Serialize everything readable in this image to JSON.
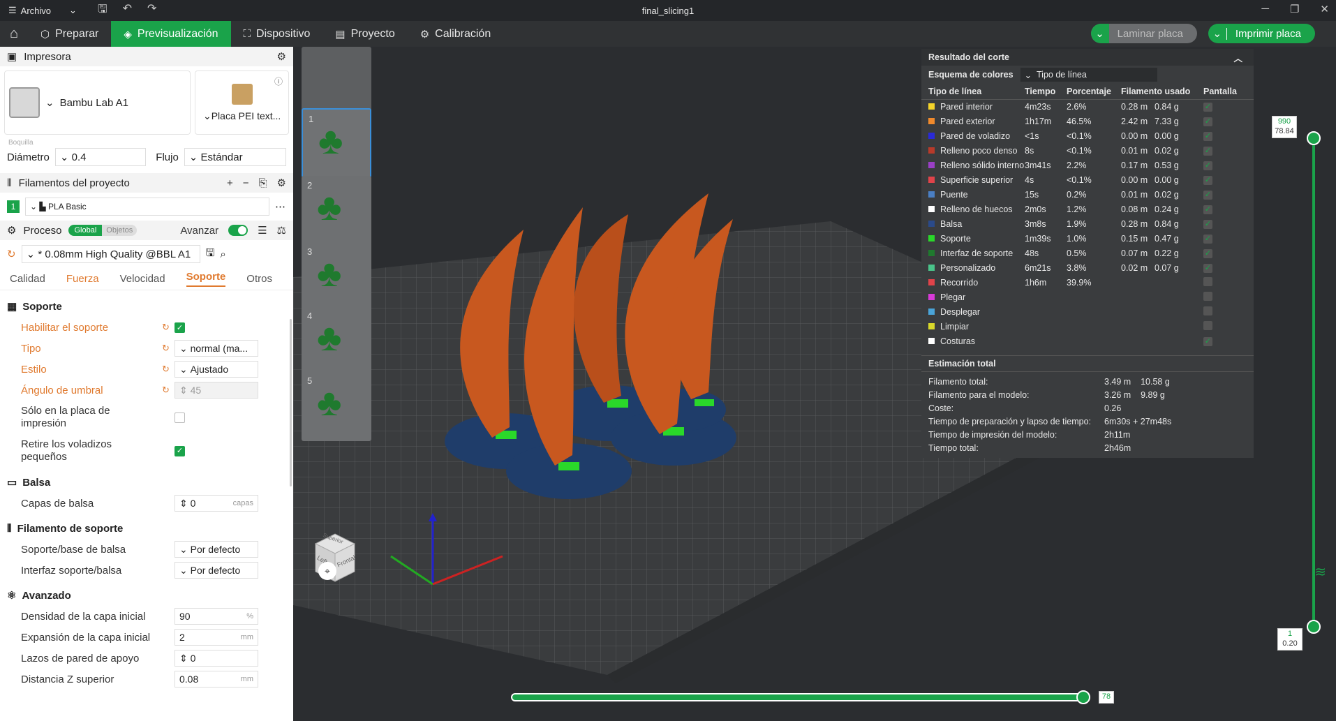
{
  "titlebar": {
    "menu_label": "Archivo",
    "window_title": "final_slicing1"
  },
  "nav": {
    "tabs": [
      {
        "label": "Preparar"
      },
      {
        "label": "Previsualización"
      },
      {
        "label": "Dispositivo"
      },
      {
        "label": "Proyecto"
      },
      {
        "label": "Calibración"
      }
    ],
    "slice_label": "Laminar placa",
    "print_label": "Imprimir placa"
  },
  "sidebar": {
    "printer_header": "Impresora",
    "printer_name": "Bambu Lab A1",
    "plate_name": "Placa PEI text...",
    "nozzle_label": "Boquilla",
    "diameter_label": "Diámetro",
    "diameter_value": "0.4",
    "flow_label": "Flujo",
    "flow_value": "Estándar",
    "filaments_header": "Filamentos del proyecto",
    "filament_index": "1",
    "filament_name": "PLA Basic",
    "process_label": "Proceso",
    "global_label": "Global",
    "objects_label": "Objetos",
    "advanced_label": "Avanzar",
    "profile": "* 0.08mm High Quality @BBL A1",
    "tabs": [
      "Calidad",
      "Fuerza",
      "Velocidad",
      "Soporte",
      "Otros"
    ],
    "groups": {
      "support": "Soporte",
      "raft": "Balsa",
      "support_filament": "Filamento de soporte",
      "advanced": "Avanzado"
    },
    "options": {
      "enable_support": "Habilitar el soporte",
      "type": "Tipo",
      "type_value": "normal (ma...",
      "style": "Estilo",
      "style_value": "Ajustado",
      "threshold": "Ángulo de umbral",
      "threshold_value": "45",
      "only_plate": "Sólo en la placa de impresión",
      "remove_small": "Retire los voladizos pequeños",
      "raft_layers": "Capas de balsa",
      "raft_layers_value": "0",
      "raft_layers_unit": "capas",
      "support_base": "Soporte/base de balsa",
      "support_base_value": "Por defecto",
      "support_interface": "Interfaz soporte/balsa",
      "support_interface_value": "Por defecto",
      "initial_density": "Densidad de la capa inicial",
      "initial_density_value": "90",
      "initial_density_unit": "%",
      "initial_expansion": "Expansión de la capa inicial",
      "initial_expansion_value": "2",
      "initial_expansion_unit": "mm",
      "wall_loops": "Lazos de pared de apoyo",
      "wall_loops_value": "0",
      "top_z": "Distancia Z superior",
      "top_z_value": "0.08",
      "top_z_unit": "mm"
    }
  },
  "plates": [
    "1",
    "2",
    "3",
    "4",
    "5"
  ],
  "results": {
    "title": "Resultado del corte",
    "scheme_label": "Esquema de colores",
    "scheme_value": "Tipo de línea",
    "columns": [
      "Tipo de línea",
      "Tiempo",
      "Porcentaje",
      "Filamento usado",
      "Pantalla"
    ],
    "rows": [
      {
        "name": "Pared interior",
        "color": "#f5d42a",
        "time": "4m23s",
        "pct": "2.6%",
        "len": "0.28 m",
        "wt": "0.84 g",
        "on": true
      },
      {
        "name": "Pared exterior",
        "color": "#f08a2c",
        "time": "1h17m",
        "pct": "46.5%",
        "len": "2.42 m",
        "wt": "7.33 g",
        "on": true
      },
      {
        "name": "Pared de voladizo",
        "color": "#2a2ad8",
        "time": "<1s",
        "pct": "<0.1%",
        "len": "0.00 m",
        "wt": "0.00 g",
        "on": true
      },
      {
        "name": "Relleno poco denso",
        "color": "#b83a2a",
        "time": "8s",
        "pct": "<0.1%",
        "len": "0.01 m",
        "wt": "0.02 g",
        "on": true
      },
      {
        "name": "Relleno sólido interno",
        "color": "#9a3fc6",
        "time": "3m41s",
        "pct": "2.2%",
        "len": "0.17 m",
        "wt": "0.53 g",
        "on": true
      },
      {
        "name": "Superficie superior",
        "color": "#e0434a",
        "time": "4s",
        "pct": "<0.1%",
        "len": "0.00 m",
        "wt": "0.00 g",
        "on": true
      },
      {
        "name": "Puente",
        "color": "#4a7fc4",
        "time": "15s",
        "pct": "0.2%",
        "len": "0.01 m",
        "wt": "0.02 g",
        "on": true
      },
      {
        "name": "Relleno de huecos",
        "color": "#ffffff",
        "time": "2m0s",
        "pct": "1.2%",
        "len": "0.08 m",
        "wt": "0.24 g",
        "on": true
      },
      {
        "name": "Balsa",
        "color": "#2a4a8a",
        "time": "3m8s",
        "pct": "1.9%",
        "len": "0.28 m",
        "wt": "0.84 g",
        "on": true
      },
      {
        "name": "Soporte",
        "color": "#2ad82a",
        "time": "1m39s",
        "pct": "1.0%",
        "len": "0.15 m",
        "wt": "0.47 g",
        "on": true
      },
      {
        "name": "Interfaz de soporte",
        "color": "#1f7a2e",
        "time": "48s",
        "pct": "0.5%",
        "len": "0.07 m",
        "wt": "0.22 g",
        "on": true
      },
      {
        "name": "Personalizado",
        "color": "#4ac48a",
        "time": "6m21s",
        "pct": "3.8%",
        "len": "0.02 m",
        "wt": "0.07 g",
        "on": true
      },
      {
        "name": "Recorrido",
        "color": "#e0434a",
        "time": "1h6m",
        "pct": "39.9%",
        "len": "",
        "wt": "",
        "on": false
      },
      {
        "name": "Plegar",
        "color": "#d83ad8",
        "time": "",
        "pct": "",
        "len": "",
        "wt": "",
        "on": false
      },
      {
        "name": "Desplegar",
        "color": "#4aa4d8",
        "time": "",
        "pct": "",
        "len": "",
        "wt": "",
        "on": false
      },
      {
        "name": "Limpiar",
        "color": "#d8d82a",
        "time": "",
        "pct": "",
        "len": "",
        "wt": "",
        "on": false
      },
      {
        "name": "Costuras",
        "color": "#ffffff",
        "time": "",
        "pct": "",
        "len": "",
        "wt": "",
        "on": true
      }
    ],
    "estimate_title": "Estimación total",
    "estimates": [
      {
        "k": "Filamento total:",
        "v": "3.49 m    10.58 g"
      },
      {
        "k": "Filamento para el modelo:",
        "v": "3.26 m    9.89 g"
      },
      {
        "k": "Coste:",
        "v": "0.26"
      },
      {
        "k": "Tiempo de preparación y lapso de tiempo:",
        "v": "6m30s + 27m48s"
      },
      {
        "k": "Tiempo de impresión del modelo:",
        "v": "2h11m"
      },
      {
        "k": "Tiempo total:",
        "v": "2h46m"
      }
    ]
  },
  "layers": {
    "top_layer": "990",
    "top_height": "78.84",
    "bottom_layer": "1",
    "bottom_height": "0.20",
    "move_value": "78"
  },
  "cube": {
    "top": "Superior",
    "left": "Left",
    "front": "Frontal"
  },
  "colors": {
    "accent": "#1aa34a",
    "orange": "#e07a2f",
    "part": "#c8581f"
  }
}
